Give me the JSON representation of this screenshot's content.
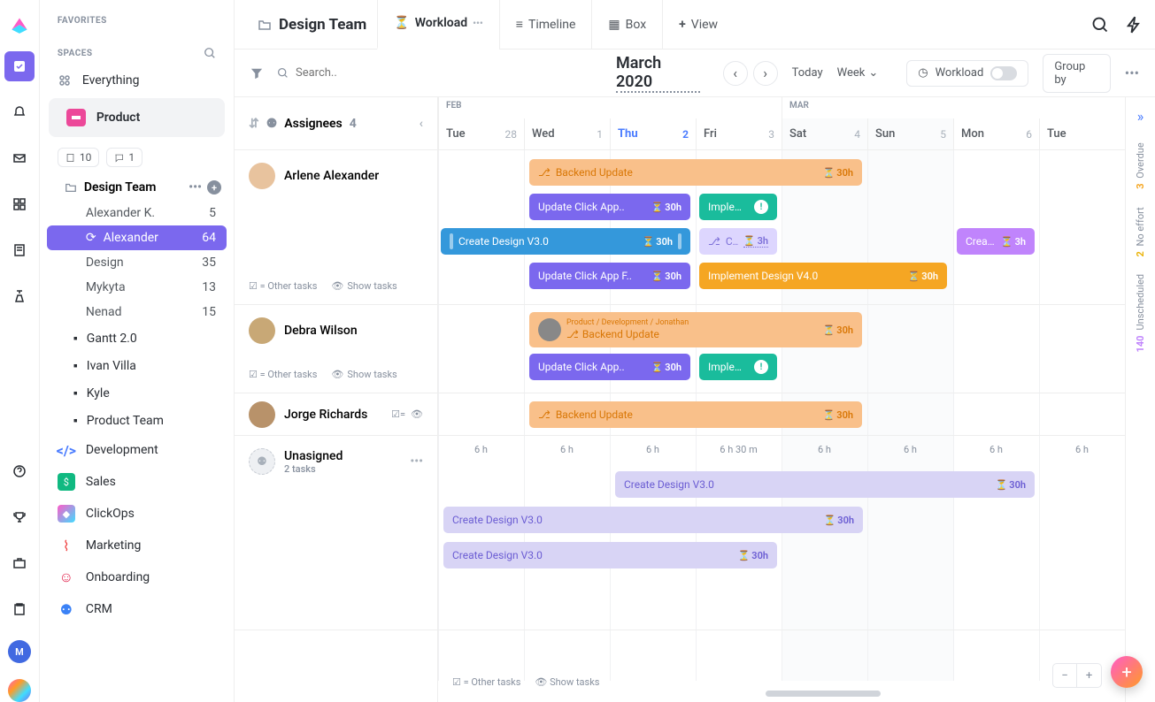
{
  "sidebar": {
    "favorites_label": "FAVORITES",
    "spaces_label": "SPACES",
    "everything": "Everything",
    "product": "Product",
    "chip_docs": "10",
    "chip_chats": "1",
    "design_team": "Design Team",
    "tree": [
      {
        "label": "Alexander K.",
        "count": "5"
      },
      {
        "label": "Alexander",
        "count": "64"
      },
      {
        "label": "Design",
        "count": "35"
      },
      {
        "label": "Mykyta",
        "count": "13"
      },
      {
        "label": "Nenad",
        "count": "15"
      }
    ],
    "folders": [
      "Gantt 2.0",
      "Ivan Villa",
      "Kyle",
      "Product Team"
    ],
    "spaces": [
      {
        "label": "Development",
        "color": "#4a7cff"
      },
      {
        "label": "Sales",
        "color": "#10b981"
      },
      {
        "label": "ClickOps",
        "color": ""
      },
      {
        "label": "Marketing",
        "color": "#ef4444"
      },
      {
        "label": "Onboarding",
        "color": "#e11d48"
      },
      {
        "label": "CRM",
        "color": "#3b82f6"
      }
    ]
  },
  "header": {
    "title": "Design Team",
    "tabs": {
      "workload": "Workload",
      "timeline": "Timeline",
      "box": "Box",
      "view": "View"
    }
  },
  "toolbar": {
    "search_placeholder": "Search..",
    "month": "March 2020",
    "today": "Today",
    "week": "Week",
    "workload": "Workload",
    "groupby": "Group by"
  },
  "cal": {
    "feb": "FEB",
    "mar": "MAR",
    "days": [
      {
        "dow": "Tue",
        "num": "28"
      },
      {
        "dow": "Wed",
        "num": "1"
      },
      {
        "dow": "Thu",
        "num": "2",
        "today": true
      },
      {
        "dow": "Fri",
        "num": "3"
      },
      {
        "dow": "Sat",
        "num": "4",
        "holiday": true
      },
      {
        "dow": "Sun",
        "num": "5",
        "holiday": true
      },
      {
        "dow": "Mon",
        "num": "6"
      },
      {
        "dow": "Tue",
        "num": ""
      }
    ]
  },
  "assignees": {
    "label": "Assignees",
    "count": "4",
    "other": "= Other tasks",
    "show": "Show tasks",
    "list": [
      {
        "name": "Arlene Alexander"
      },
      {
        "name": "Debra Wilson"
      },
      {
        "name": "Jorge Richards"
      },
      {
        "name": "Unasigned",
        "sub": "2 tasks"
      }
    ]
  },
  "tasks": {
    "backend": "Backend Update",
    "update_click": "Update Click App..",
    "update_click_f": "Update Click App F..",
    "implem": "Implem..",
    "implement_v4": "Implement Design V4.0",
    "create_v3": "Create Design V3.0",
    "create_short": "Crea..",
    "create_dots": "Create..",
    "bc": "Product / Development / Jonathan",
    "h30": "30h",
    "h3": "3h"
  },
  "hours": [
    "6 h",
    "6 h",
    "6 h",
    "6 h 30 m",
    "6 h",
    "6 h",
    "6 h",
    "6 h"
  ],
  "rightrail": {
    "overdue": {
      "n": "3",
      "t": "Overdue"
    },
    "noeffort": {
      "n": "2",
      "t": "No effort"
    },
    "unscheduled": {
      "n": "140",
      "t": "Unscheduled"
    }
  }
}
